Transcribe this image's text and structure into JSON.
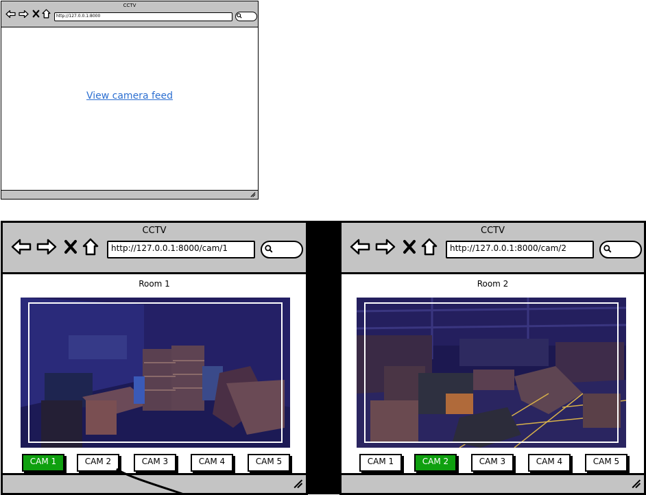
{
  "window_small": {
    "title": "CCTV",
    "url": "http://127.0.0.1:8000",
    "link": "View camera feed"
  },
  "window_cam1": {
    "title": "CCTV",
    "url": "http://127.0.0.1:8000/cam/1",
    "room": "Room 1",
    "cams": [
      "CAM 1",
      "CAM 2",
      "CAM 3",
      "CAM 4",
      "CAM 5"
    ],
    "active_cam": "CAM 1"
  },
  "window_cam2": {
    "title": "CCTV",
    "url": "http://127.0.0.1:8000/cam/2",
    "room": "Room 2",
    "cams": [
      "CAM 1",
      "CAM 2",
      "CAM 3",
      "CAM 4",
      "CAM 5"
    ],
    "active_cam": "CAM 2"
  },
  "colors": {
    "chrome": "#c4c4c4",
    "link": "#2c6fd1",
    "active_cam": "#0fa00f"
  },
  "icons": [
    "back-arrow-icon",
    "forward-arrow-icon",
    "stop-icon",
    "home-icon",
    "search-icon",
    "resize-grip-icon"
  ]
}
